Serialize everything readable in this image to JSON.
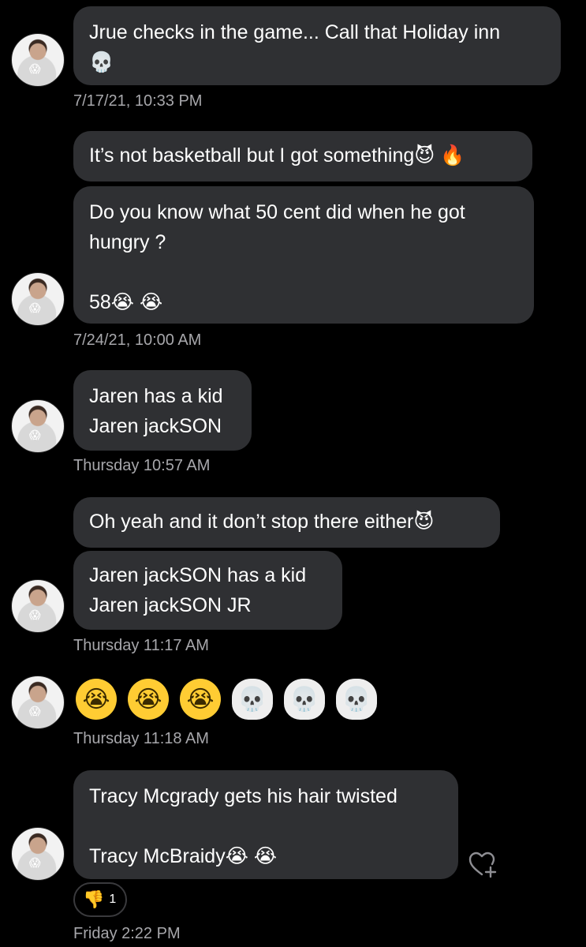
{
  "conversation": {
    "messages": [
      {
        "text": "Jrue checks in the game... Call that Holiday inn\n💀"
      },
      {
        "text": "It’s not basketball but I got something😈 🔥"
      },
      {
        "text": "Do you know what 50 cent did when he got\nhungry ?\n\n58😭 😭"
      },
      {
        "text": "Jaren has a kid\nJaren jackSON"
      },
      {
        "text": "Oh yeah and it don’t stop there either😈"
      },
      {
        "text": "Jaren jackSON has a kid\nJaren jackSON JR"
      },
      {
        "text": "Tracy Mcgrady gets his hair twisted\n\nTracy McBraidy😭 😭"
      }
    ],
    "timestamps": [
      "7/17/21, 10:33 PM",
      "7/24/21, 10:00 AM",
      "Thursday 10:57 AM",
      "Thursday 11:17 AM",
      "Thursday 11:18 AM",
      "Friday 2:22 PM"
    ],
    "emoji_message": {
      "items": [
        "😭",
        "😭",
        "😭",
        "💀",
        "💀",
        "💀"
      ]
    },
    "reaction": {
      "emoji": "👎",
      "count": "1"
    }
  },
  "avatar": {
    "badge": "😱"
  },
  "icons": {
    "like": "heart-plus-icon"
  }
}
